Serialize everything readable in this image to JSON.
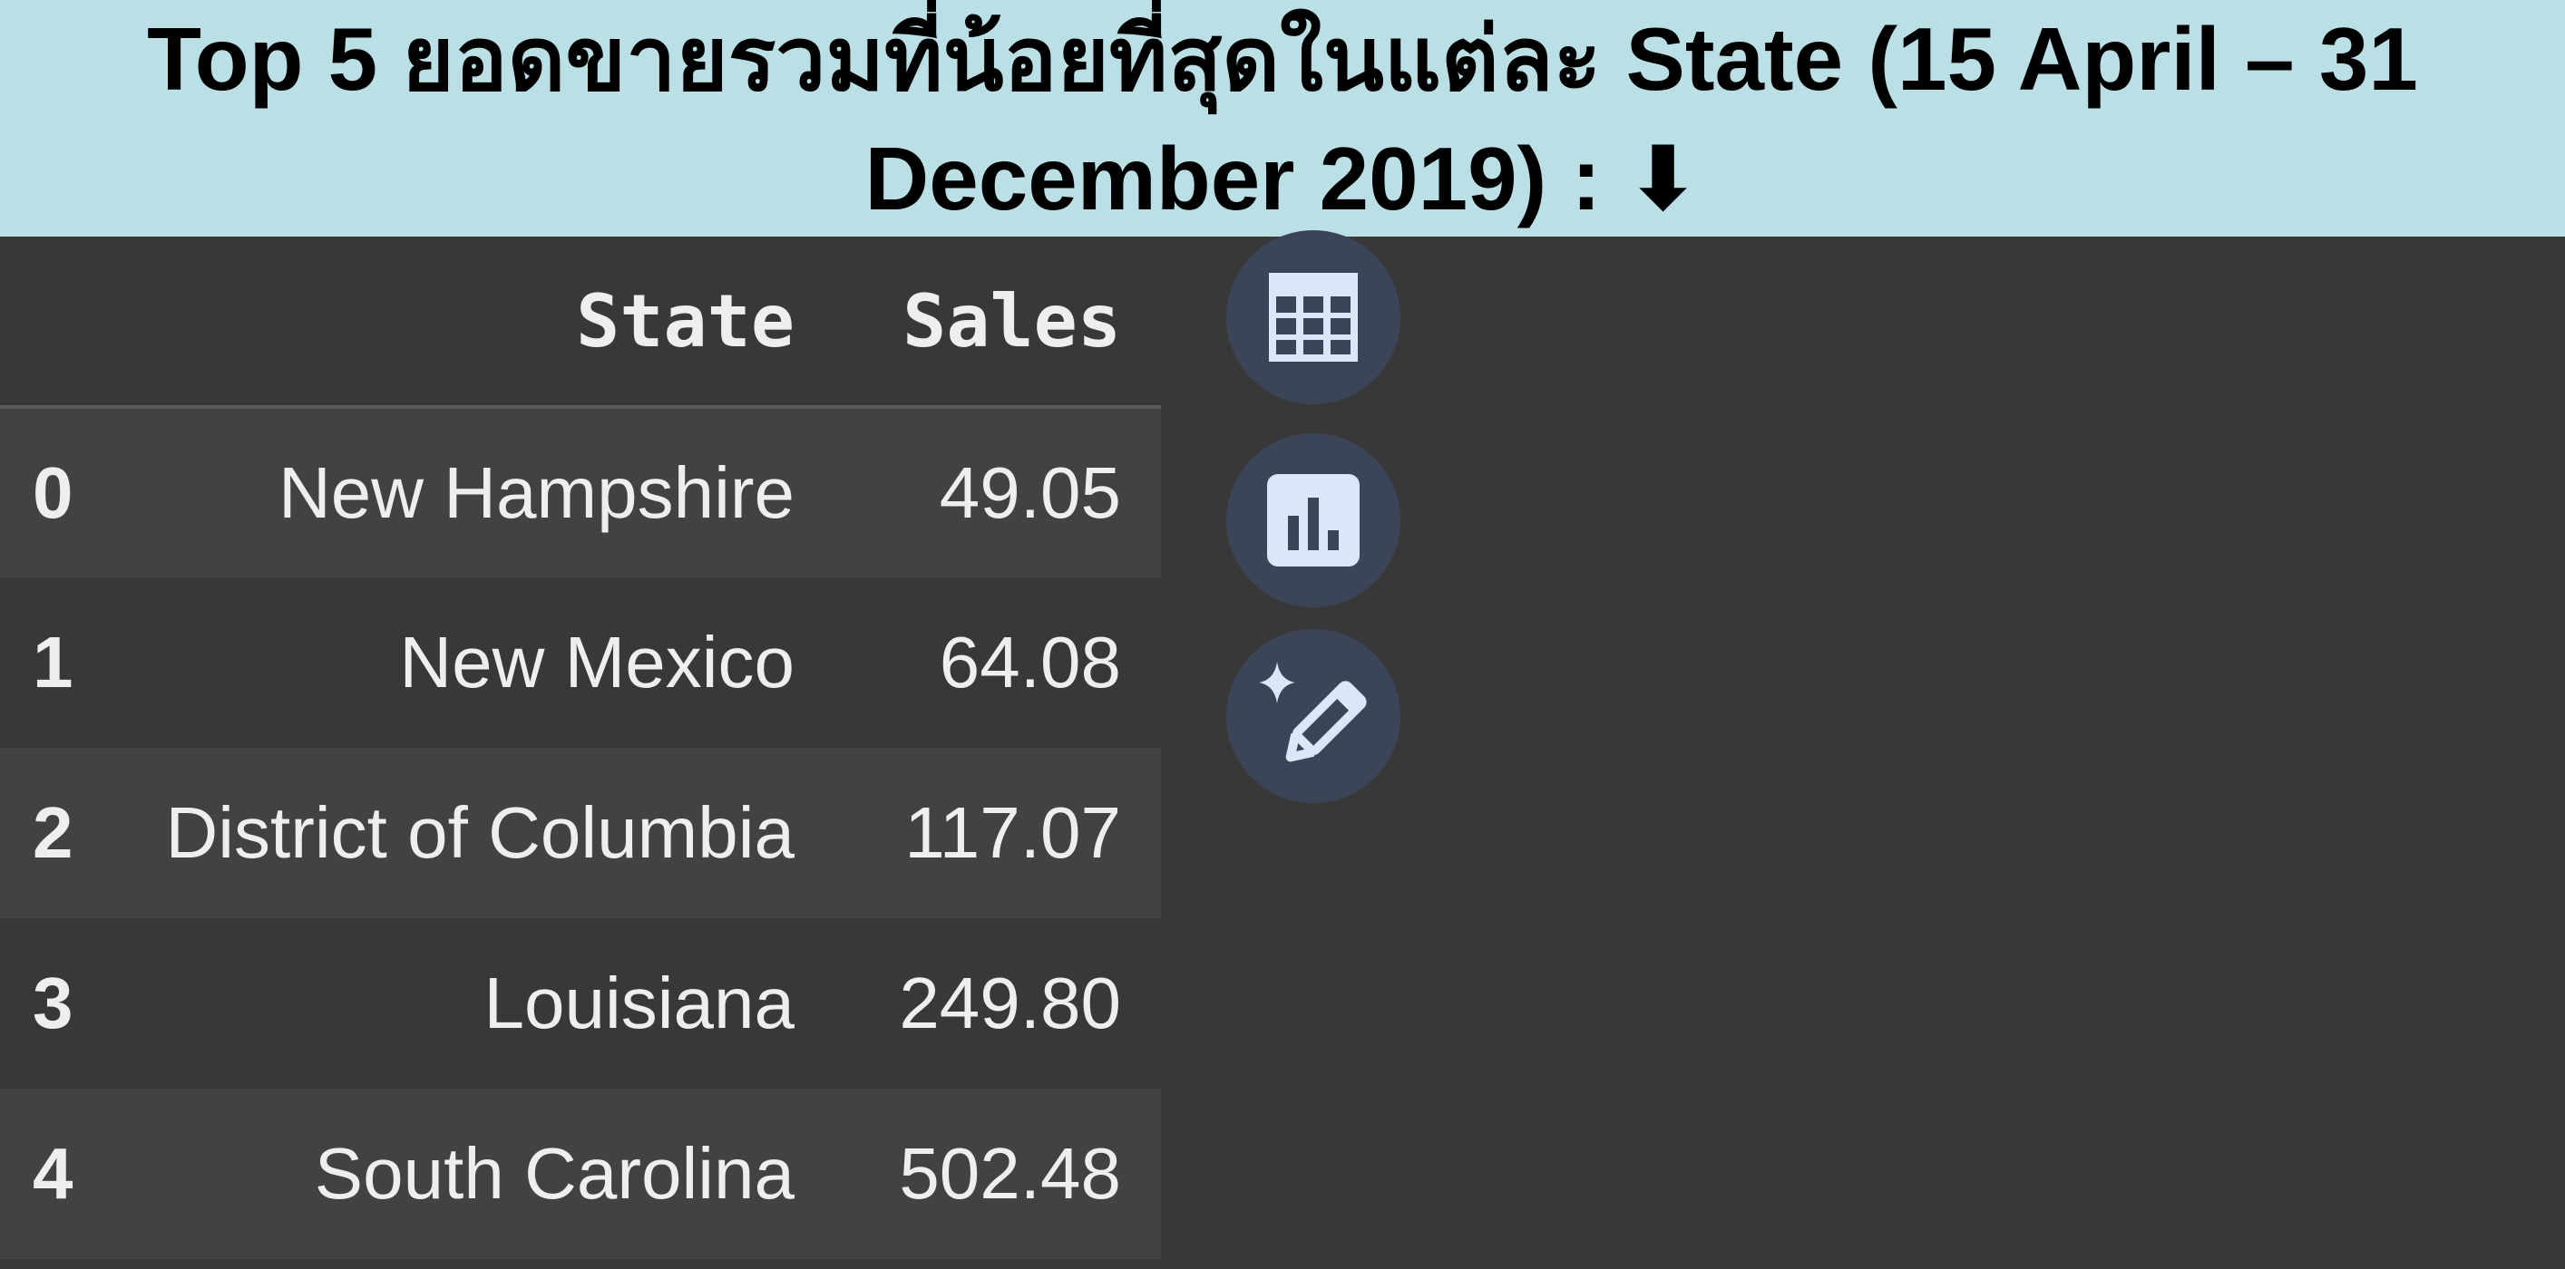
{
  "header": {
    "title": "Top 5 ยอดขายรวมที่น้อยที่สุดในแต่ละ State (15 April – 31 December 2019) : ⬇"
  },
  "table": {
    "columns": [
      "",
      "State",
      "Sales"
    ],
    "rows": [
      {
        "index": "0",
        "state": "New Hampshire",
        "sales": "49.05"
      },
      {
        "index": "1",
        "state": "New Mexico",
        "sales": "64.08"
      },
      {
        "index": "2",
        "state": "District of Columbia",
        "sales": "117.07"
      },
      {
        "index": "3",
        "state": "Louisiana",
        "sales": "249.80"
      },
      {
        "index": "4",
        "state": "South Carolina",
        "sales": "502.48"
      }
    ]
  },
  "actions": {
    "icons": [
      "table-grid-icon",
      "bar-chart-icon",
      "magic-pencil-icon"
    ]
  },
  "colors": {
    "title_background": "#badfe5",
    "background": "#383838",
    "row_alt": "#424242",
    "button_background": "#3c4557",
    "icon_color": "#dbe6fd"
  }
}
